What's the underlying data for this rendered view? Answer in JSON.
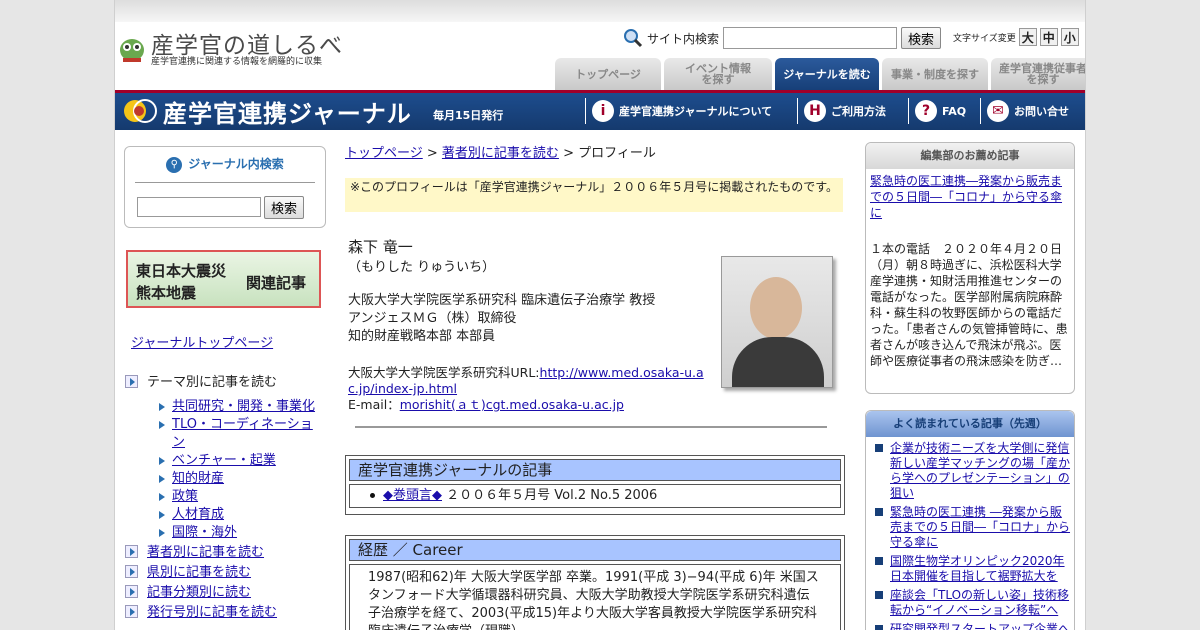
{
  "header": {
    "logo_title": "産学官の道しるべ",
    "logo_sub": "産学官連携に関連する情報を網羅的に収集",
    "search_label": "サイト内検索",
    "search_button": "検索",
    "fontsize_label": "文字サイズ変更",
    "fontsize_large": "大",
    "fontsize_medium": "中",
    "fontsize_small": "小",
    "tabs": [
      {
        "label": "トップページ"
      },
      {
        "label": "イベント情報\nを探す"
      },
      {
        "label": "ジャーナルを読む"
      },
      {
        "label": "事業・制度を探す"
      },
      {
        "label": "産学官連携従事者\nを探す"
      }
    ]
  },
  "banner": {
    "title": "産学官連携ジャーナル",
    "sub": "毎月15日発行",
    "nav": [
      {
        "icon": "i",
        "label": "産学官連携ジャーナルについて"
      },
      {
        "icon": "H",
        "label": "ご利用方法"
      },
      {
        "icon": "?",
        "label": "FAQ"
      },
      {
        "icon": "✉",
        "label": "お問い合せ"
      }
    ]
  },
  "left": {
    "search_title": "ジャーナル内検索",
    "search_button": "検索",
    "quake_l1": "東日本大震災",
    "quake_l2": "熊本地震",
    "quake_r": "関連記事",
    "journal_top": "ジャーナルトップページ",
    "theme_label": "テーマ別に記事を読む",
    "themes": [
      "共同研究・開発・事業化",
      "TLO・コーディネーション",
      "ベンチャー・起業",
      "知的財産",
      "政策",
      "人材育成",
      "国際・海外"
    ],
    "more": [
      "著者別に記事を読む",
      "県別に記事を読む",
      "記事分類別に読む",
      "発行号別に記事を読む"
    ]
  },
  "main": {
    "crumb_top": "トップページ",
    "crumb_sep": " > ",
    "crumb_author": "著者別に記事を読む",
    "crumb_current": "プロフィール",
    "notice": "※このプロフィールは「産学官連携ジャーナル」２００６年５月号に掲載されたものです。",
    "name": "森下 竜一",
    "kana": "（もりした りゅういち）",
    "affiliations": [
      "大阪大学大学院医学系研究科 臨床遺伝子治療学 教授",
      "アンジェスＭＧ（株）取締役",
      "知的財産戦略本部 本部員"
    ],
    "url_label": "大阪大学大学院医学系研究科URL:",
    "url": "http://www.med.osaka-u.ac.jp/index-jp.html",
    "email_label": "E-mail：",
    "email": "morishit(ａｔ)cgt.med.osaka-u.ac.jp",
    "articles_title": "産学官連携ジャーナルの記事",
    "article_link": "◆巻頭言◆",
    "article_issue": " ２００６年５月号 Vol.2 No.5 2006",
    "career_title": "経歴 ／ Career",
    "career_text": "1987(昭和62)年 大阪大学医学部 卒業。1991(平成 3)−94(平成 6)年 米国スタンフォード大学循環器科研究員、大阪大学助教授大学院医学系研究科遺伝子治療学を経て、2003(平成15)年より大阪大学客員教授大学院医学系研究科臨床遺伝子治療学（現職）"
  },
  "right": {
    "rec_title": "編集部のお薦め記事",
    "rec_link": "緊急時の医工連携―発案から販売までの５日間―「コロナ」から守る傘に",
    "rec_text": "１本の電話　２０２０年４月２０日（月）朝８時過ぎに、浜松医科大学産学連携・知財活用推進センターの電話がなった。医学部附属病院麻酔科・蘇生科の牧野医師からの電話だった。「患者さんの気管挿管時に、患者さんが咳き込んで飛沫が飛ぶ。医師や医療従事者の飛沫感染を防ぎ…",
    "popular_title": "よく読まれている記事（先週）",
    "popular": [
      "企業が技術ニーズを大学側に発信 新しい産学マッチングの場「産から学へのプレゼンテーション」の狙い",
      "緊急時の医工連携 ―発案から販売までの５日間―「コロナ」から守る傘に",
      "国際生物学オリンピック2020年日本開催を目指して裾野拡大を",
      "座談会「TLOの新しい姿」技術移転から“イノベーション移転”へ",
      "研究開発型スタートアップ企業への"
    ]
  }
}
